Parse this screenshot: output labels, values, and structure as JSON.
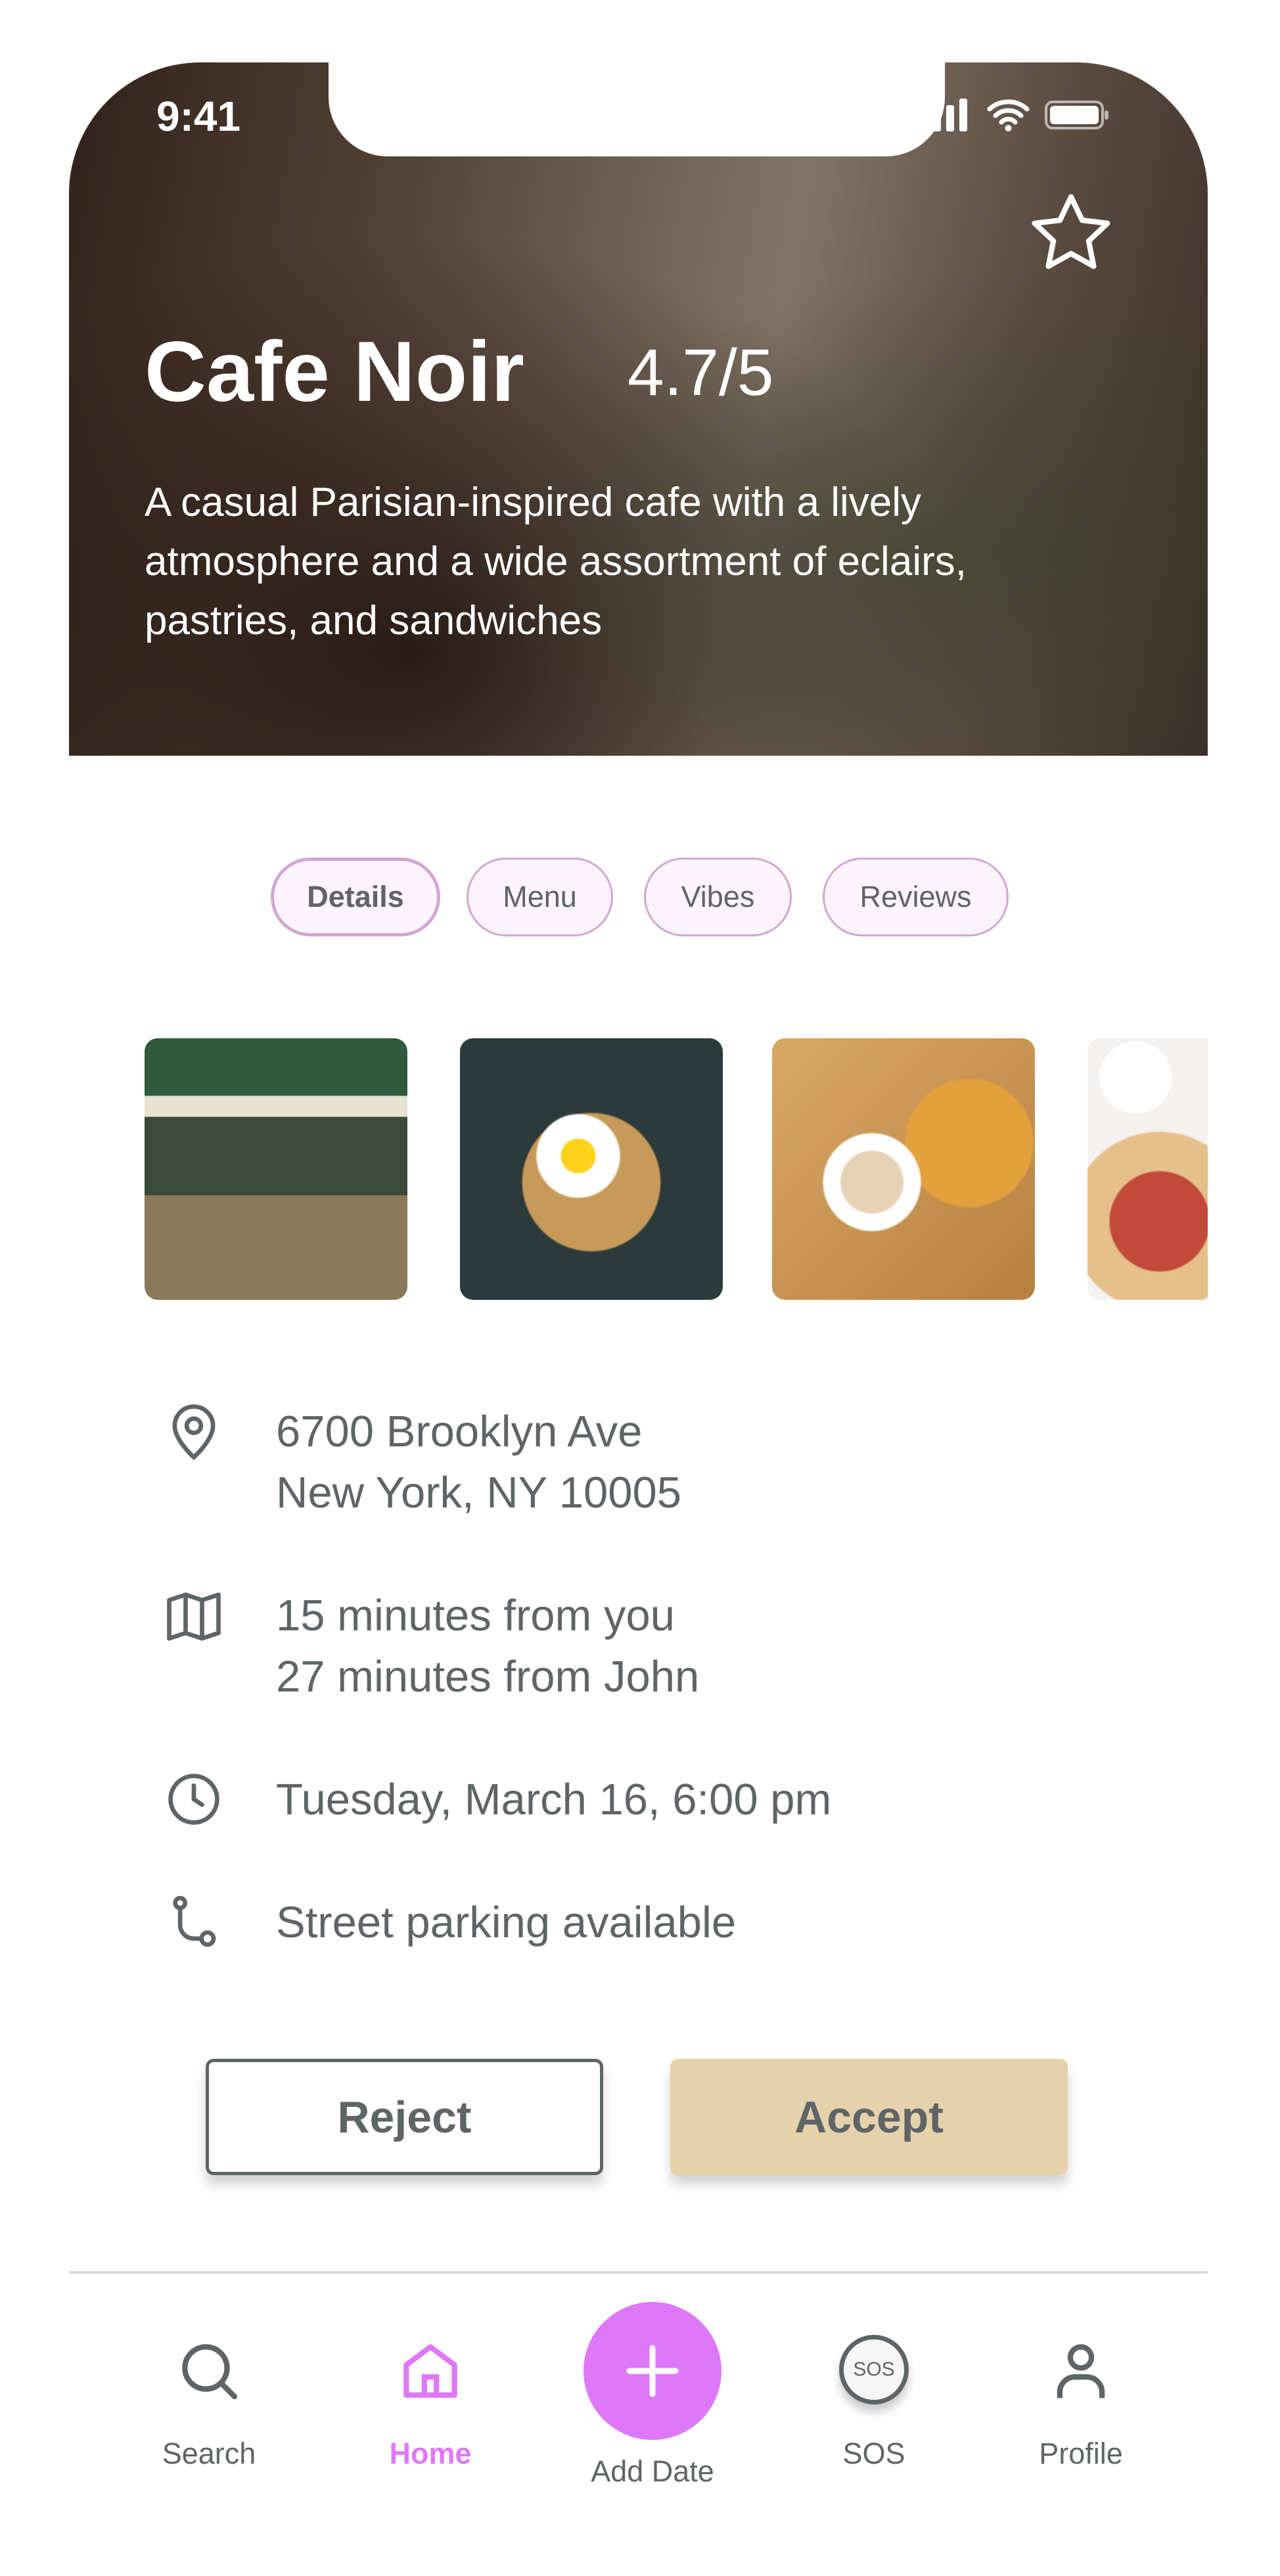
{
  "status_bar": {
    "time": "9:41"
  },
  "hero": {
    "title": "Cafe Noir",
    "rating": "4.7/5",
    "description": "A casual Parisian-inspired cafe with a lively atmosphere and a wide assortment of eclairs, pastries, and sandwiches",
    "favorite_icon": "star-outline-icon"
  },
  "tabs": [
    {
      "label": "Details",
      "active": true
    },
    {
      "label": "Menu"
    },
    {
      "label": "Vibes"
    },
    {
      "label": "Reviews"
    }
  ],
  "photos": [
    "storefront",
    "eggs-toast",
    "coffee-pastries",
    "french-toast"
  ],
  "details": {
    "address": [
      "6700 Brooklyn Ave",
      "New York, NY 10005"
    ],
    "distance": [
      "15 minutes from you",
      "27 minutes from John"
    ],
    "time": "Tuesday, March 16, 6:00 pm",
    "parking": "Street parking available"
  },
  "actions": {
    "reject": "Reject",
    "accept": "Accept"
  },
  "nav": [
    {
      "label": "Search"
    },
    {
      "label": "Home",
      "active": true
    },
    {
      "label": "Add Date"
    },
    {
      "label": "SOS",
      "icon_text": "SOS"
    },
    {
      "label": "Profile"
    }
  ],
  "colors": {
    "accent": "#df78f8",
    "tab_border": "#d2a6d2",
    "tab_bg": "#fcf3fd",
    "accept_bg": "#e5d2ab",
    "text": "#5f6466"
  }
}
